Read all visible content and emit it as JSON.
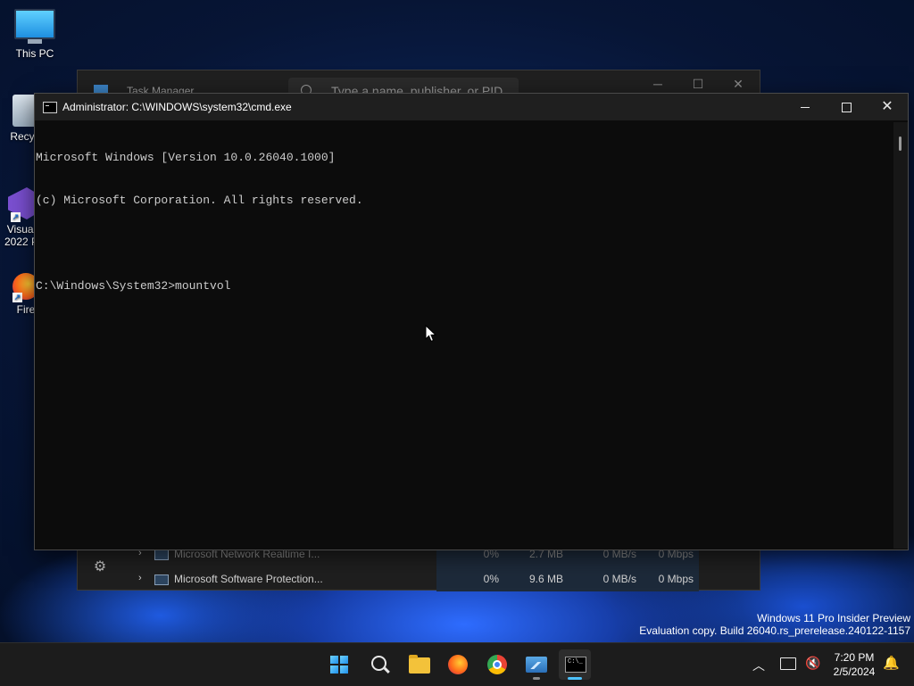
{
  "desktop": {
    "icons": [
      {
        "label": "This PC"
      },
      {
        "label": "Recyc"
      },
      {
        "label": "Visual\n2022 P"
      },
      {
        "label": "Fire"
      }
    ]
  },
  "task_manager": {
    "title": "Task Manager",
    "search_placeholder": "Type a name, publisher, or PID",
    "rows": [
      {
        "name": "Microsoft Network Realtime I...",
        "cpu": "0%",
        "memory": "2.7 MB",
        "disk": "0 MB/s",
        "network": "0 Mbps"
      },
      {
        "name": "Microsoft Software Protection...",
        "cpu": "0%",
        "memory": "9.6 MB",
        "disk": "0 MB/s",
        "network": "0 Mbps"
      }
    ]
  },
  "cmd": {
    "title": "Administrator: C:\\WINDOWS\\system32\\cmd.exe",
    "lines": [
      "Microsoft Windows [Version 10.0.26040.1000]",
      "(c) Microsoft Corporation. All rights reserved.",
      "",
      "C:\\Windows\\System32>mountvol"
    ]
  },
  "watermark": {
    "line1": "Windows 11 Pro Insider Preview",
    "line2": "Evaluation copy. Build 26040.rs_prerelease.240122-1157"
  },
  "taskbar": {
    "time": "7:20 PM",
    "date": "2/5/2024"
  },
  "colors": {
    "console_bg": "#0c0c0c",
    "console_fg": "#cccccc",
    "accent": "#4cc2ff",
    "taskbar_bg": "#1c1c1c"
  }
}
